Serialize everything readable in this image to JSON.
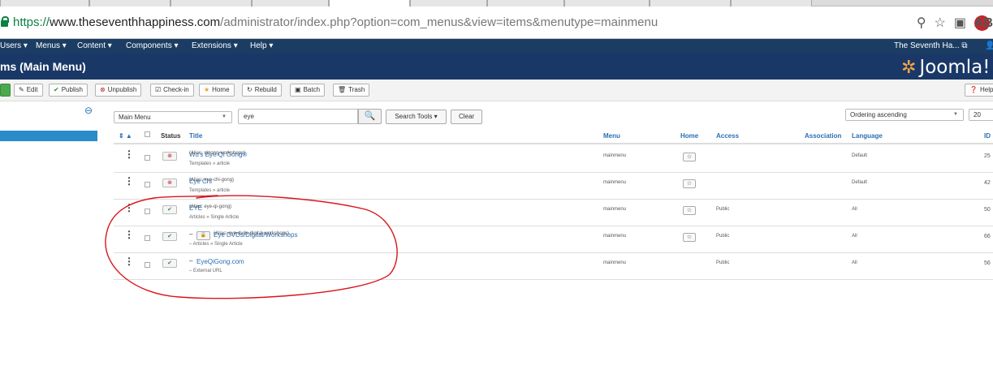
{
  "browser": {
    "url_scheme": "https://",
    "url_host": "www.theseventhhappiness.com",
    "url_path": "/administrator/index.php?option=com_menus&view=items&menutype=mainmenu",
    "abp_label": "ABP"
  },
  "menubar": {
    "items": [
      "Users ▾",
      "Menus ▾",
      "Content ▾",
      "Components ▾",
      "Extensions ▾",
      "Help ▾"
    ],
    "site_name": "The Seventh Ha... ⧉"
  },
  "header": {
    "page_title": "ms (Main Menu)",
    "logo_text": "Joomla!"
  },
  "toolbar": {
    "edit": "Edit",
    "publish": "Publish",
    "unpublish": "Unpublish",
    "checkin": "Check-in",
    "home": "Home",
    "rebuild": "Rebuild",
    "batch": "Batch",
    "trash": "Trash",
    "help": "Help"
  },
  "filters": {
    "menu_select": "Main Menu",
    "search_value": "eye",
    "search_tools": "Search Tools ▾",
    "clear": "Clear",
    "ordering": "Ordering ascending",
    "limit": "20"
  },
  "columns": {
    "status": "Status",
    "title": "Title",
    "menu": "Menu",
    "home": "Home",
    "access": "Access",
    "association": "Association",
    "language": "Language",
    "id": "ID"
  },
  "rows": [
    {
      "title": "Wu's Eye Qi Gong®",
      "alias": "(Alias: qigong-workshops)",
      "sub": "Templates » article",
      "menu": "mainmenu",
      "access": "",
      "language": "Default",
      "id": "25",
      "status": "unpublished",
      "home": true
    },
    {
      "title": "Eye Chi",
      "alias": "(Alias: eye-chi-gong)",
      "sub": "Templates » article",
      "menu": "mainmenu",
      "access": "",
      "language": "Default",
      "id": "42",
      "status": "unpublished",
      "home": true
    },
    {
      "title": "EYE",
      "alias": "(Alias: eye-qi-gong)",
      "sub": "Articles » Single Article",
      "menu": "mainmenu",
      "access": "Public",
      "language": "All",
      "id": "50",
      "status": "published",
      "home": true
    },
    {
      "title": "Eye DVDs/Digital/Workshops",
      "alias": "(Alias: eye-dvds-digital-workshops)",
      "sub": "– Articles » Single Article",
      "menu": "mainmenu",
      "access": "Public",
      "language": "All",
      "id": "66",
      "status": "published",
      "home": true,
      "prefix": "–"
    },
    {
      "title": "EyeQiGong.com",
      "alias": "",
      "sub": "– External URL",
      "menu": "mainmenu",
      "access": "Public",
      "language": "All",
      "id": "56",
      "status": "published",
      "home": false,
      "prefix": "–"
    }
  ],
  "colors": {
    "menubar_bg": "#1c3d63",
    "titlebar_bg": "#1a3867",
    "link": "#2a6fb5",
    "annotation": "#d9141c"
  }
}
